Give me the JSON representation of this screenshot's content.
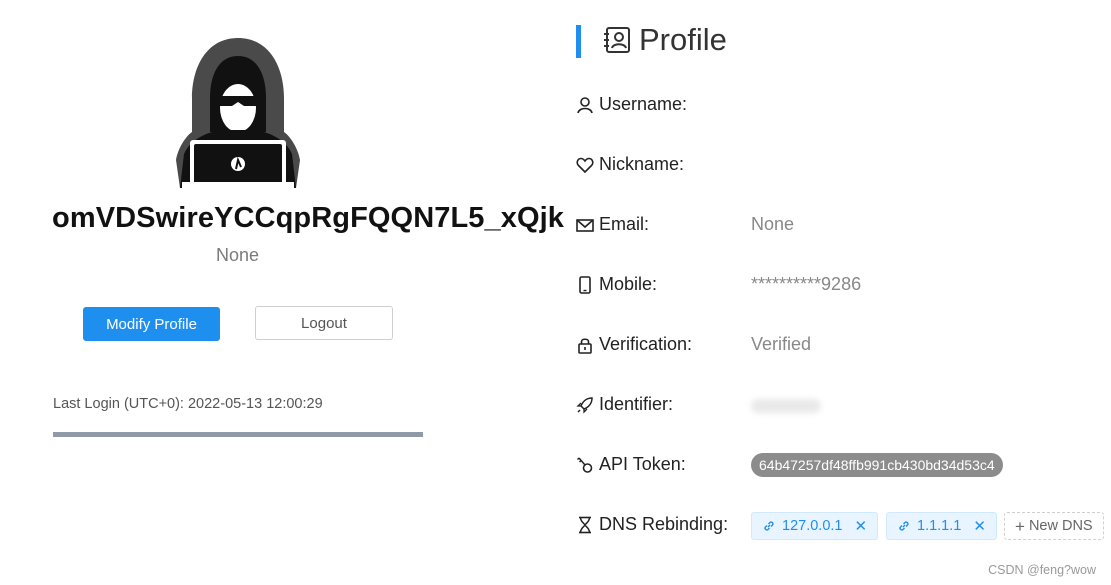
{
  "user": {
    "display_name": "omVDSwireYCCqpRgFQQN7L5_xQjk",
    "subtitle": "None",
    "last_login": "Last Login (UTC+0): 2022-05-13 12:00:29",
    "login_progress": 1.0
  },
  "actions": {
    "modify_label": "Modify Profile",
    "logout_label": "Logout"
  },
  "profile": {
    "title": "Profile",
    "fields": {
      "username": {
        "label": "Username:",
        "value": ""
      },
      "nickname": {
        "label": "Nickname:",
        "value": ""
      },
      "email": {
        "label": "Email:",
        "value": "None"
      },
      "mobile": {
        "label": "Mobile:",
        "value": "**********9286"
      },
      "verification": {
        "label": "Verification:",
        "value": "Verified"
      },
      "identifier": {
        "label": "Identifier:",
        "value": ""
      },
      "api_token": {
        "label": "API Token:",
        "value": "64b47257df48ffb991cb430bd34d53c4"
      },
      "dns_rebinding": {
        "label": "DNS Rebinding:",
        "tags": [
          "127.0.0.1",
          "1.1.1.1"
        ],
        "new_label": "New DNS"
      }
    }
  },
  "icons": {
    "tag_link": "link-icon",
    "tag_close": "close-icon"
  },
  "colors": {
    "accent": "#1f8fef",
    "token_bg": "#8c8c8c",
    "tag_bg": "#e8f4ff",
    "progress": "#909aa7"
  },
  "watermark": "CSDN @feng?wow"
}
